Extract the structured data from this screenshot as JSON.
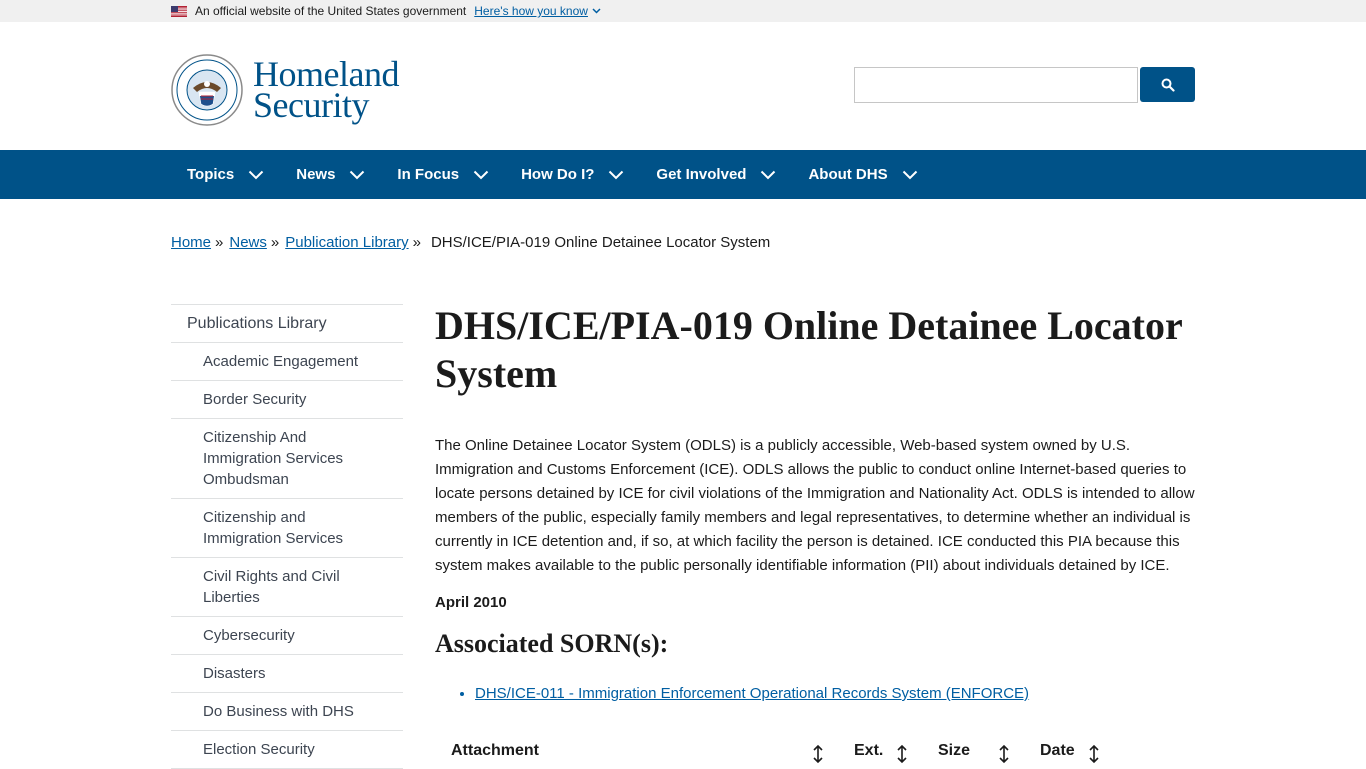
{
  "gov_banner": {
    "text": "An official website of the United States government",
    "how_link": "Here's how you know"
  },
  "logo": {
    "line1": "Homeland",
    "line2": "Security",
    "seal_text_top": "U.S. DEPARTMENT OF",
    "seal_text_bottom": "HOMELAND SECURITY"
  },
  "search": {
    "placeholder": ""
  },
  "nav": {
    "items": [
      {
        "label": "Topics"
      },
      {
        "label": "News"
      },
      {
        "label": "In Focus"
      },
      {
        "label": "How Do I?"
      },
      {
        "label": "Get Involved"
      },
      {
        "label": "About DHS"
      }
    ]
  },
  "breadcrumb": {
    "home": "Home",
    "news": "News",
    "publication_library": "Publication Library",
    "current": "DHS/ICE/PIA-019 Online Detainee Locator System",
    "sep": "»"
  },
  "sidenav": {
    "items": [
      {
        "label": "Publications Library"
      },
      {
        "label": "Academic Engagement"
      },
      {
        "label": "Border Security"
      },
      {
        "label": "Citizenship And Immigration Services Ombudsman"
      },
      {
        "label": "Citizenship and Immigration Services"
      },
      {
        "label": "Civil Rights and Civil Liberties"
      },
      {
        "label": "Cybersecurity"
      },
      {
        "label": "Disasters"
      },
      {
        "label": "Do Business with DHS"
      },
      {
        "label": "Election Security"
      }
    ]
  },
  "main": {
    "title": "DHS/ICE/PIA-019 Online Detainee Locator System",
    "summary": "The Online Detainee Locator System (ODLS) is a publicly accessible, Web-based system owned by U.S. Immigration and Customs Enforcement (ICE). ODLS allows the public to conduct online Internet-based queries to locate persons detained by ICE for civil violations of the Immigration and Nationality Act. ODLS is intended to allow members of the public, especially family members and legal representatives, to determine whether an individual is currently in ICE detention and, if so, at which facility the person is detained. ICE conducted this PIA because this system makes available to the public personally identifiable information (PII) about individuals detained by ICE.",
    "date": "April 2010",
    "sorn_heading": "Associated SORN(s):",
    "sorn_link": "DHS/ICE-011 - Immigration Enforcement Operational Records System (ENFORCE)"
  },
  "attachments_table": {
    "columns": [
      {
        "label": "Attachment"
      },
      {
        "label": "Ext."
      },
      {
        "label": "Size"
      },
      {
        "label": "Date"
      }
    ]
  },
  "colors": {
    "brand_blue": "#005288",
    "link_blue": "#005ea2",
    "banner_gray": "#f0f0f0"
  }
}
